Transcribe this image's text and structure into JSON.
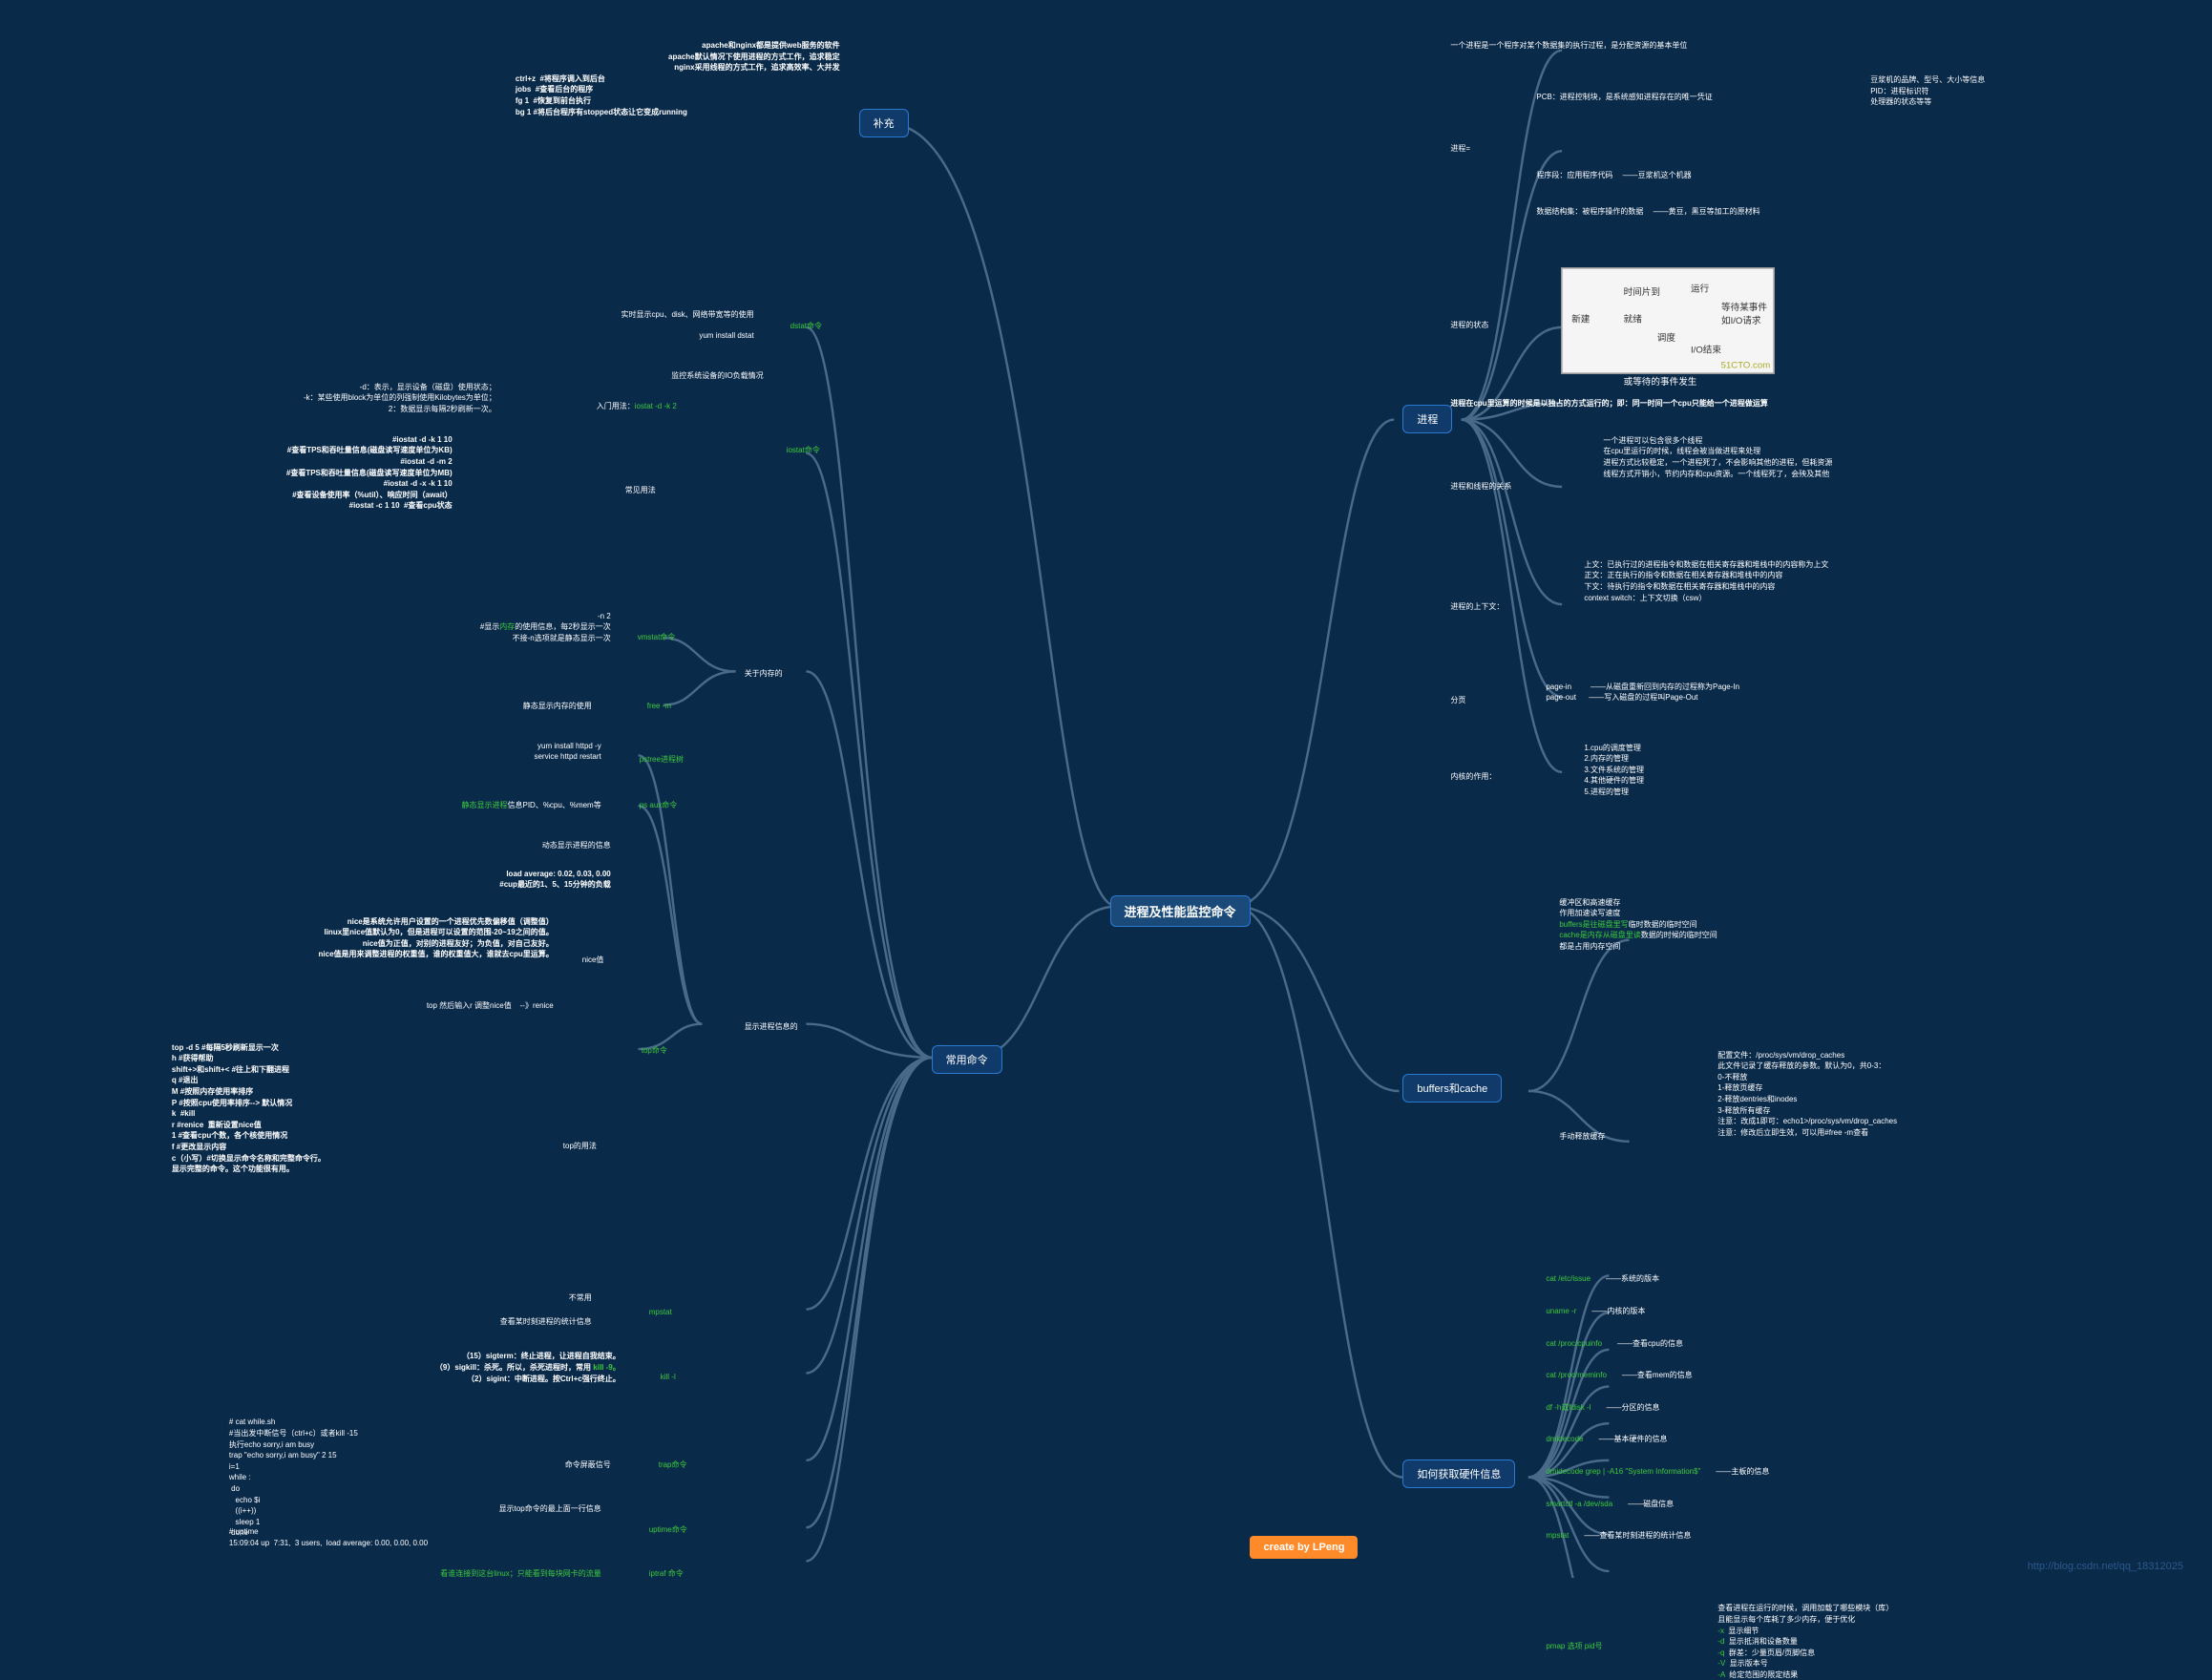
{
  "root": "进程及性能监控命令",
  "credit": "create by LPeng",
  "watermark": "http://blog.csdn.net/qq_18312025",
  "left": {
    "supplement": {
      "label": "补充",
      "lines": [
        "apache和nginx都是提供web服务的软件",
        "apache默认情况下使用进程的方式工作，追求稳定",
        "nginx采用线程的方式工作，追求高效率、大并发",
        "ctrl+z  #将程序调入到后台",
        "jobs  #查看后台的程序",
        "fg 1  #恢复到前台执行",
        "bg 1 #将后台程序有stopped状态让它变成running"
      ]
    },
    "common": {
      "label": "常用命令",
      "dstat": {
        "label": "dstat命令",
        "l1": "实时显示cpu、disk、网络带宽等的使用",
        "l2": "yum install dstat"
      },
      "iostat": {
        "label": "iostat命令",
        "intro": "入门用法：iostat -d -k 2",
        "intro_desc": "监控系统设备的IO负载情况",
        "opts": "-d：表示，显示设备（磁盘）使用状态；\n-k：某些使用block为单位的列强制使用Kilobytes为单位；\n2：数据显示每隔2秒刷新一次。",
        "usage_label": "常见用法",
        "usage": "#iostat -d -k 1 10\n#查看TPS和吞吐量信息(磁盘读写速度单位为KB)\n#iostat -d -m 2\n#查看TPS和吞吐量信息(磁盘读写速度单位为MB)\n#iostat -d -x -k 1 10\n#查看设备使用率（%util）、响应时间（await）\n#iostat -c 1 10  #查看cpu状态"
      },
      "mem": {
        "label": "关于内存的",
        "vmstat": "vmstat命令",
        "vmstat_lines": "-n 2\n#显示内存的使用信息，每2秒显示一次\n不接-n选项就是静态显示一次",
        "free": "free -m",
        "free_desc": "静态显示内存的使用"
      },
      "show": {
        "label": "显示进程信息的",
        "pstree": "pstree进程树",
        "pstree_lines": "yum install httpd -y\nservice httpd restart",
        "psaux": "ps aux命令",
        "psaux_desc": "静态显示进程信息PID、%cpu、%mem等",
        "top": {
          "label": "top命令",
          "dyn": "动态显示进程的信息",
          "load": "load average: 0.02, 0.03, 0.00\n#cup最近的1、5、15分钟的负载",
          "nice_label": "nice值",
          "nice": "nice是系统允许用户设置的一个进程优先数偏移值（调整值）\nlinux里nice值默认为0，但是进程可以设置的范围-20~19之间的值。\nnice值为正值，对别的进程友好；为负值，对自己友好。\nnice值是用来调整进程的权重值，谁的权重值大，谁就去cpu里运算。",
          "renice": "top 然后输入r 调整nice值    --》renice",
          "usage_label": "top的用法",
          "usage": "top -d 5 #每隔5秒刷新显示一次\nh #获得帮助\nshift+>和shift+< #往上和下翻进程\nq #退出\nM #按照内存使用率排序\nP #按照cpu使用率排序--> 默认情况\nk  #kill\nr #renice  重新设置nice值\n1 #查看cpu个数，各个核使用情况\nf #更改显示内容\nc（小写）#切换显示命令名称和完整命令行。\n显示完整的命令。这个功能很有用。"
        }
      },
      "mpstat": {
        "label": "mpstat",
        "l1": "不常用",
        "l2": "查看某时刻进程的统计信息"
      },
      "kill": {
        "label": "kill -l",
        "lines": "（15）sigterm：终止进程，让进程自我结束。\n（9）sigkill：杀死。所以，杀死进程时，常用 kill -9。\n（2）sigint：中断进程。按Ctrl+c强行终止。"
      },
      "trap": {
        "label": "trap命令",
        "desc": "命令屏蔽信号",
        "code": "# cat while.sh\n#当出发中断信号（ctrl+c）或者kill -15\n执行echo sorry,i am busy\ntrap \"echo sorry,i am busy\" 2 15\ni=1\nwhile :\n do\n   echo $i\n   ((i++))\n   sleep 1\n done"
      },
      "uptime": {
        "label": "uptime命令",
        "desc": "显示top命令的最上面一行信息",
        "code": "# uptime\n15:09:04 up  7:31,  3 users,  load average: 0.00, 0.00, 0.00"
      },
      "iptraf": {
        "label": "iptraf 命令",
        "desc": "看谁连接到这台linux；只能看到每块网卡的流量"
      }
    }
  },
  "right": {
    "process": {
      "label": "进程",
      "def": "一个进程是一个程序对某个数据集的执行过程，是分配资源的基本单位",
      "eq_label": "进程=",
      "eq": {
        "pcb": "PCB：进程控制块，是系统感知进程存在的唯一凭证",
        "pcb_sub": "豆浆机的品牌、型号、大小等信息\nPID：进程标识符\n处理器的状态等等",
        "seg": "程序段：应用程序代码",
        "seg_sub": "豆浆机这个机器",
        "data": "数据结构集：被程序操作的数据",
        "data_sub": "黄豆，黑豆等加工的原材料"
      },
      "state_label": "进程的状态",
      "cpu": "进程在cpu里运算的时候是以独占的方式运行的；即：同一时间一个cpu只能给一个进程做运算",
      "rel_label": "进程和线程的关系",
      "rel": "一个进程可以包含很多个线程\n在cpu里运行的时候，线程会被当做进程来处理\n进程方式比较稳定，一个进程死了，不会影响其他的进程，但耗资源\n线程方式开销小，节约内存和cpu资源。一个线程死了，会殃及其他",
      "ctx_label": "进程的上下文：",
      "ctx": "上文：已执行过的进程指令和数据在相关寄存器和堆栈中的内容称为上文\n正文：正在执行的指令和数据在相关寄存器和堆栈中的内容\n下文：待执行的指令和数据在相关寄存器和堆栈中的内容\ncontext switch：上下文切换（csw）",
      "page_label": "分页",
      "page": "page-in         ——从磁盘重新回到内存的过程称为Page-In\npage-out      ——写入磁盘的过程叫Page-Out",
      "kernel_label": "内核的作用：",
      "kernel": "1.cpu的调度管理\n2.内存的管理\n3.文件系统的管理\n4.其他硬件的管理\n5.进程的管理"
    },
    "buffers": {
      "label": "buffers和cache",
      "lines": "缓冲区和高速缓存\n作用加速读写速度\nbuffers是往磁盘里写临时数据的临时空间\ncache是内存从磁盘里读数据的时候的临时空间\n都是占用内存空间",
      "manual_label": "手动释放缓存",
      "manual": "配置文件：/proc/sys/vm/drop_caches\n此文件记录了缓存释放的参数。默认为0，共0-3：\n0-不释放\n1-释放页缓存\n2-释放dentries和inodes\n3-释放所有缓存\n注意：改成1即可：echo1>/proc/sys/vm/drop_caches\n注意：修改后立即生效，可以用#free -m查看"
    },
    "hw": {
      "label": "如何获取硬件信息",
      "items": [
        {
          "cmd": "cat /etc/issue",
          "desc": "系统的版本"
        },
        {
          "cmd": "uname -r",
          "desc": "内核的版本"
        },
        {
          "cmd": "cat /proc/cpuinfo",
          "desc": "查看cpu的信息"
        },
        {
          "cmd": "cat /proc/meminfo",
          "desc": "查看mem的信息"
        },
        {
          "cmd": "df -h或fdisk -l",
          "desc": "分区的信息"
        },
        {
          "cmd": "dmidecode",
          "desc": "基本硬件的信息"
        },
        {
          "cmd": "dmidecode grep | -A16 \"System Information$\"",
          "desc": "主板的信息"
        },
        {
          "cmd": "smartctl -a /dev/sda",
          "desc": "磁盘信息"
        },
        {
          "cmd": "mpstat",
          "desc": "查看某时刻进程的统计信息"
        }
      ],
      "pmap_label": "pmap 选项 pid号",
      "pmap": "查看进程在运行的时候，调用加载了哪些模块（库）\n且能显示每个库耗了多少内存，便于优化\n-x  显示细节\n-d  显示抵消和设备数量\n-q  群差：少量页眉/页脚信息\n-V  显示版本号\n-A  给定范围的限定结果"
    }
  }
}
